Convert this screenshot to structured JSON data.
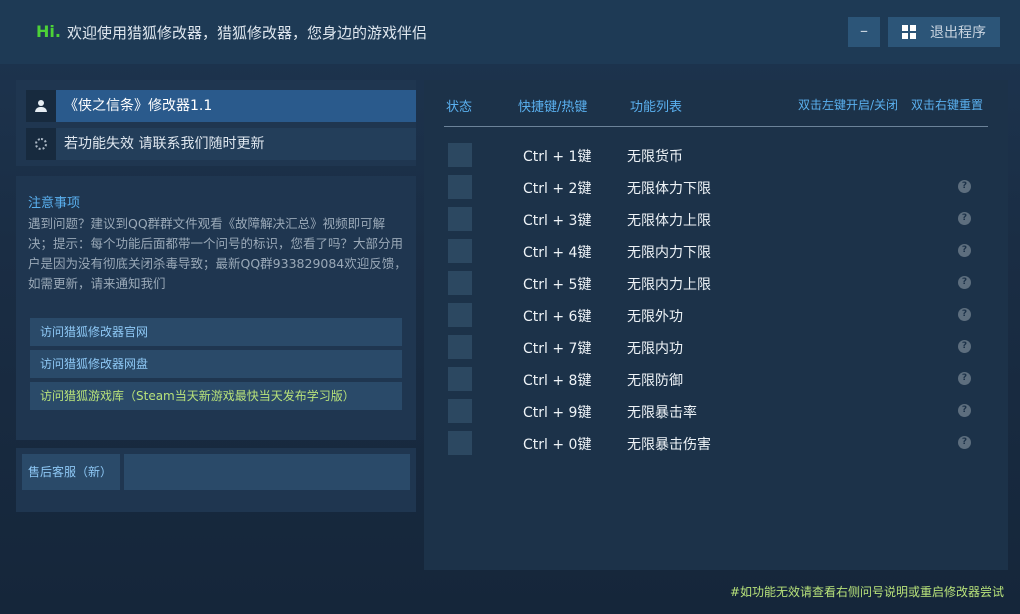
{
  "header": {
    "hi": "Hi.",
    "welcome": "欢迎使用猎狐修改器，猎狐修改器，您身边的游戏伴侣",
    "minimize_label": "–",
    "exit_label": "退出程序"
  },
  "title_panel": {
    "game_title": "《侠之信条》修改器1.1",
    "notice": "若功能失效  请联系我们随时更新"
  },
  "notes": {
    "title": "注意事项",
    "body": "遇到问题？建议到QQ群群文件观看《故障解决汇总》视频即可解决；提示：每个功能后面都带一个问号的标识，您看了吗？大部分用户是因为没有彻底关闭杀毒导致；最新QQ群933829084欢迎反馈，如需更新，请来通知我们",
    "links": [
      "访问猎狐修改器官网",
      "访问猎狐修改器网盘",
      "访问猎狐游戏库（Steam当天新游戏最快当天发布学习版）"
    ]
  },
  "service": {
    "label": "售后客服（新）"
  },
  "hotkeys": {
    "col_status": "状态",
    "col_hotkey": "快捷键/热键",
    "col_func": "功能列表",
    "hint_toggle": "双击左键开启/关闭",
    "hint_reset": "双击右键重置",
    "rows": [
      {
        "key": "Ctrl  +  1键",
        "func": "无限货币",
        "help": false
      },
      {
        "key": "Ctrl  +  2键",
        "func": "无限体力下限",
        "help": true
      },
      {
        "key": "Ctrl  +  3键",
        "func": "无限体力上限",
        "help": true
      },
      {
        "key": "Ctrl  +  4键",
        "func": "无限内力下限",
        "help": true
      },
      {
        "key": "Ctrl  +  5键",
        "func": "无限内力上限",
        "help": true
      },
      {
        "key": "Ctrl  +  6键",
        "func": "无限外功",
        "help": true
      },
      {
        "key": "Ctrl  +  7键",
        "func": "无限内功",
        "help": true
      },
      {
        "key": "Ctrl  +  8键",
        "func": "无限防御",
        "help": true
      },
      {
        "key": "Ctrl  +  9键",
        "func": "无限暴击率",
        "help": true
      },
      {
        "key": "Ctrl  +  0键",
        "func": "无限暴击伤害",
        "help": true
      }
    ],
    "help_glyph": "?"
  },
  "footer": {
    "note": "#如功能无效请查看右侧问号说明或重启修改器尝试"
  }
}
